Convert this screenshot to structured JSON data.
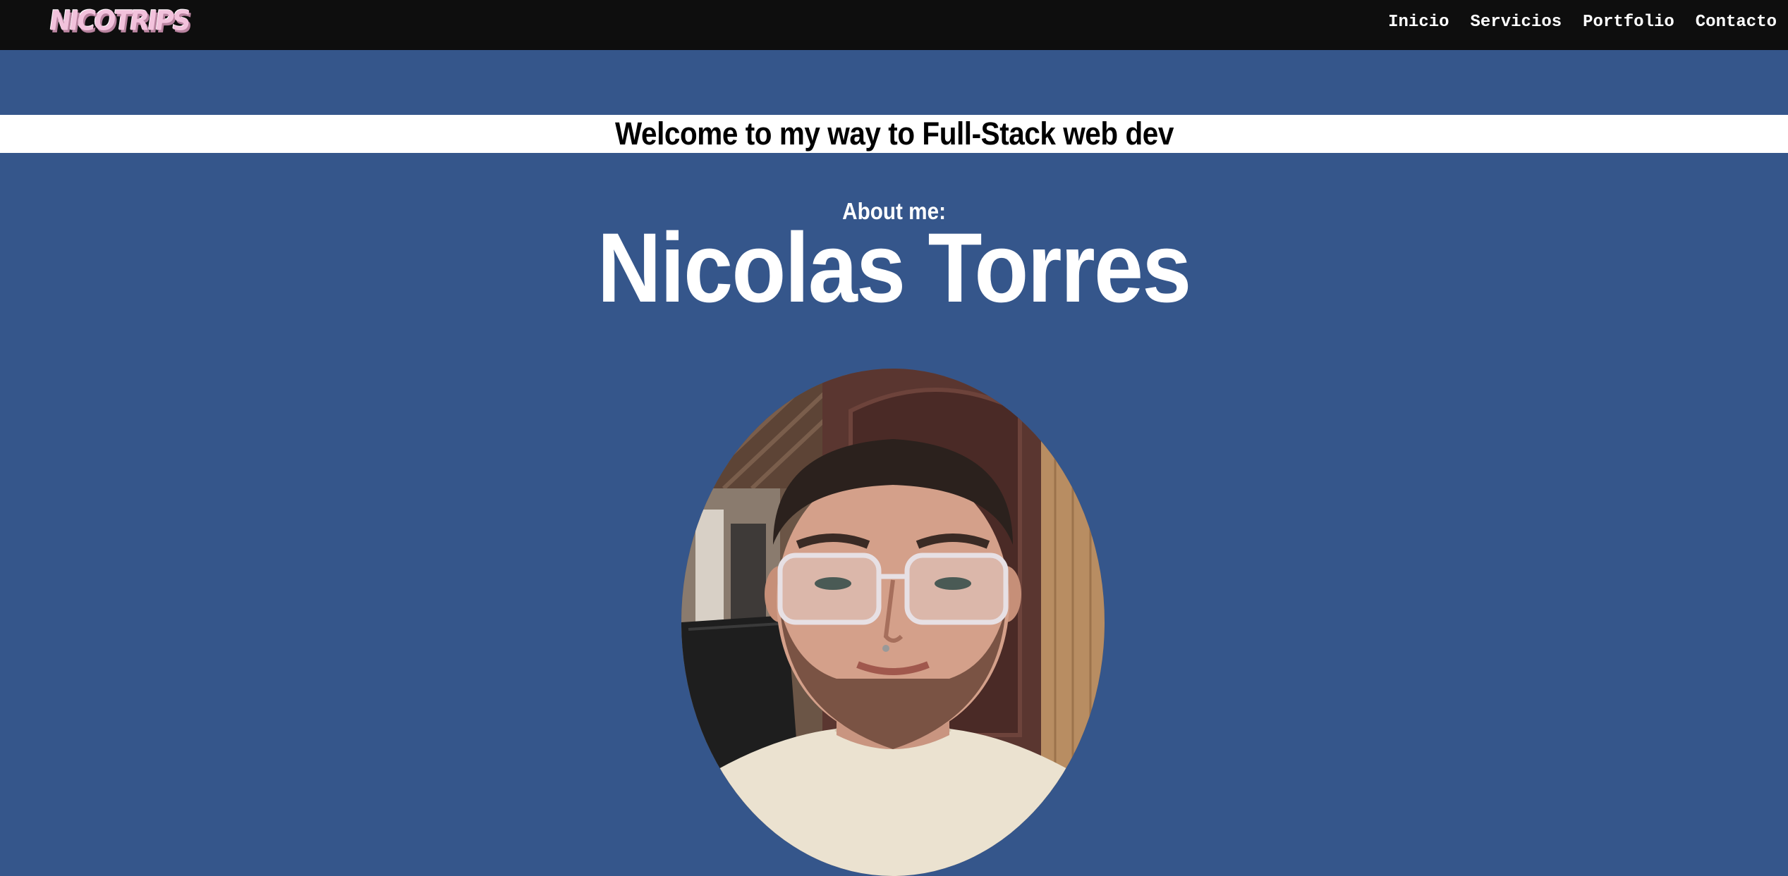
{
  "header": {
    "logo_text": "NICOTRIPS",
    "nav": [
      {
        "label": "Inicio"
      },
      {
        "label": "Servicios"
      },
      {
        "label": "Portfolio"
      },
      {
        "label": "Contacto"
      }
    ]
  },
  "hero": {
    "welcome": "Welcome to my way to Full-Stack web dev",
    "about_label": "About me:",
    "name": "Nicolas Torres"
  },
  "colors": {
    "page_background": "#35568b",
    "navbar_background": "#0e0e0e",
    "welcome_bar_background": "#ffffff",
    "logo_pink": "#f2c2dc"
  }
}
